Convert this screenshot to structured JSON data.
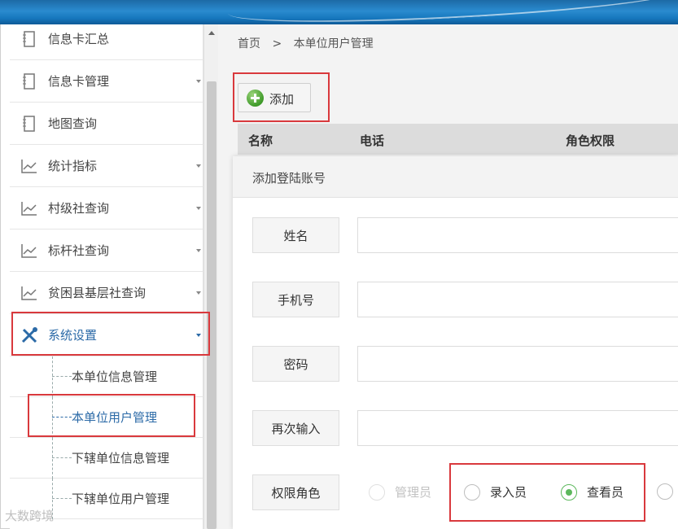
{
  "sidebar": {
    "items": [
      {
        "label": "信息卡汇总",
        "icon": "notebook-icon"
      },
      {
        "label": "信息卡管理",
        "icon": "notebook-icon"
      },
      {
        "label": "地图查询",
        "icon": "notebook-icon"
      },
      {
        "label": "统计指标",
        "icon": "line-chart-icon"
      },
      {
        "label": "村级社查询",
        "icon": "line-chart-icon"
      },
      {
        "label": "标杆社查询",
        "icon": "line-chart-icon"
      },
      {
        "label": "贫困县基层社查询",
        "icon": "line-chart-icon"
      },
      {
        "label": "系统设置",
        "icon": "wrench-screwdriver-icon"
      }
    ],
    "subitems": [
      {
        "label": "本单位信息管理"
      },
      {
        "label": "本单位用户管理"
      },
      {
        "label": "下辖单位信息管理"
      },
      {
        "label": "下辖单位用户管理"
      }
    ]
  },
  "breadcrumb": {
    "home": "首页",
    "separator": ">",
    "current": "本单位用户管理"
  },
  "toolbar": {
    "add_label": "添加"
  },
  "table": {
    "columns": [
      "名称",
      "电话",
      "角色权限"
    ]
  },
  "modal": {
    "title": "添加登陆账号",
    "fields": [
      {
        "label": "姓名",
        "value": ""
      },
      {
        "label": "手机号",
        "value": ""
      },
      {
        "label": "密码",
        "value": ""
      },
      {
        "label": "再次输入",
        "value": ""
      }
    ],
    "role": {
      "label": "权限角色",
      "options": [
        {
          "label": "管理员",
          "state": "disabled"
        },
        {
          "label": "录入员",
          "state": "unchecked"
        },
        {
          "label": "查看员",
          "state": "checked"
        }
      ]
    }
  },
  "watermark": "大数跨境",
  "colors": {
    "accent": "#2b6aa7",
    "highlight": "#d9393d",
    "radio_checked": "#5cb85c",
    "add_icon": "#3f9a2a"
  }
}
